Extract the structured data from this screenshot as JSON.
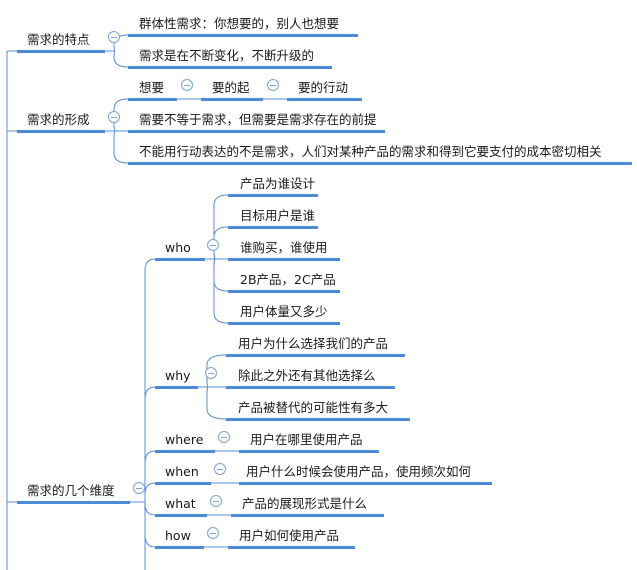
{
  "accent_color": "#4d8bd6",
  "collapse_icon": "circle-minus-icon",
  "branches": [
    {
      "label": "需求的特点",
      "children": [
        "群体性需求：你想要的，别人也想要",
        "需求是在不断变化，不断升级的"
      ]
    },
    {
      "label": "需求的形成",
      "chain": [
        "想要",
        "要的起",
        "要的行动"
      ],
      "children": [
        "需要不等于需求，但需要是需求存在的前提",
        "不能用行动表达的不是需求，人们对某种产品的需求和得到它要支付的成本密切相关"
      ]
    },
    {
      "label": "需求的几个维度",
      "dimensions": [
        {
          "label": "who",
          "children": [
            "产品为谁设计",
            "目标用户是谁",
            "谁购买，谁使用",
            "2B产品，2C产品",
            "用户体量又多少"
          ]
        },
        {
          "label": "why",
          "children": [
            "用户为什么选择我们的产品",
            "除此之外还有其他选择么",
            "产品被替代的可能性有多大"
          ]
        },
        {
          "label": "where",
          "children": [
            "用户在哪里使用产品"
          ]
        },
        {
          "label": "when",
          "children": [
            "用户什么时候会使用产品，使用频次如何"
          ]
        },
        {
          "label": "what",
          "children": [
            "产品的展现形式是什么"
          ]
        },
        {
          "label": "how",
          "children": [
            "用户如何使用产品"
          ]
        }
      ]
    }
  ]
}
